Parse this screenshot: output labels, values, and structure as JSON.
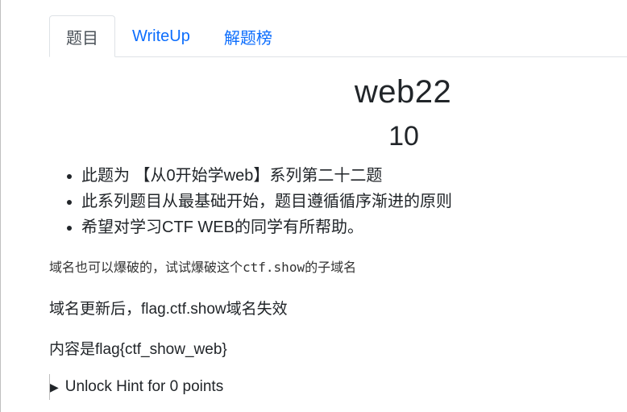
{
  "tabs": [
    {
      "label": "题目",
      "active": true
    },
    {
      "label": "WriteUp",
      "active": false
    },
    {
      "label": "解题榜",
      "active": false
    }
  ],
  "challenge": {
    "title": "web22",
    "points": "10"
  },
  "description": [
    "此题为 【从0开始学web】系列第二十二题",
    "此系列题目从最基础开始，题目遵循循序渐进的原则",
    "希望对学习CTF WEB的同学有所帮助。"
  ],
  "note": {
    "before": "域名也可以爆破的，试试爆破这个",
    "code": "ctf.show",
    "after": "的子域名"
  },
  "lines": {
    "update": "域名更新后，flag.ctf.show域名失效",
    "content": "内容是flag{ctf_show_web}"
  },
  "hint": {
    "icon": "triangle-right-icon",
    "label": "Unlock Hint for 0 points"
  },
  "colors": {
    "link": "#0d6efd",
    "text": "#212529"
  }
}
